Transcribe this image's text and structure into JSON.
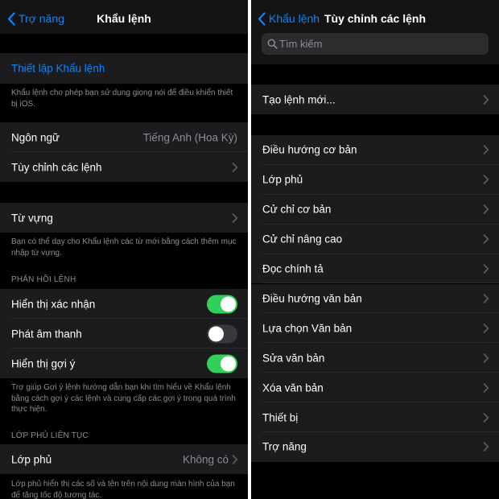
{
  "left": {
    "back_label": "Trợ năng",
    "title": "Khẩu lệnh",
    "setup_link": "Thiết lập Khẩu lệnh",
    "setup_footer": "Khẩu lệnh cho phép bạn sử dụng giọng nói để điều khiển thiết bị iOS.",
    "language_label": "Ngôn ngữ",
    "language_value": "Tiếng Anh (Hoa Kỳ)",
    "customize_label": "Tùy chỉnh các lệnh",
    "vocabulary_label": "Từ vựng",
    "vocabulary_footer": "Bạn có thể dạy cho Khẩu lệnh các từ mới bằng cách thêm mục nhập từ vựng.",
    "feedback_header": "PHẢN HỒI LỆNH",
    "toggles": [
      {
        "label": "Hiển thị xác nhận",
        "on": true
      },
      {
        "label": "Phát âm thanh",
        "on": false
      },
      {
        "label": "Hiển thị gợi ý",
        "on": true
      }
    ],
    "hints_footer": "Trợ giúp Gợi ý lệnh hướng dẫn bạn khi tìm hiểu về Khẩu lệnh bằng cách gợi ý các lệnh và cung cấp các gợi ý trong quá trình thực hiện.",
    "overlay_header": "LỚP PHỦ LIÊN TỤC",
    "overlay_label": "Lớp phủ",
    "overlay_value": "Không có",
    "overlay_footer": "Lớp phủ hiển thị các số và tên trên nội dung màn hình của bạn để tăng tốc độ tương tác."
  },
  "right": {
    "back_label": "Khẩu lệnh",
    "title": "Tùy chỉnh các lệnh",
    "search_placeholder": "Tìm kiếm",
    "new_command": "Tạo lệnh mới...",
    "categories": [
      "Điều hướng cơ bản",
      "Lớp phủ",
      "Cử chỉ cơ bản",
      "Cử chỉ nâng cao",
      "Đọc chính tả",
      "Điều hướng văn bản",
      "Lựa chọn Văn bản",
      "Sửa văn bản",
      "Xóa văn bản",
      "Thiết bị",
      "Trợ năng"
    ]
  },
  "colors": {
    "accent": "#0a84ff",
    "toggle_on": "#30d158",
    "cell_bg": "#1c1c1e"
  },
  "icons": [
    "chevron-left-icon",
    "chevron-right-icon",
    "magnifying-glass-icon"
  ]
}
